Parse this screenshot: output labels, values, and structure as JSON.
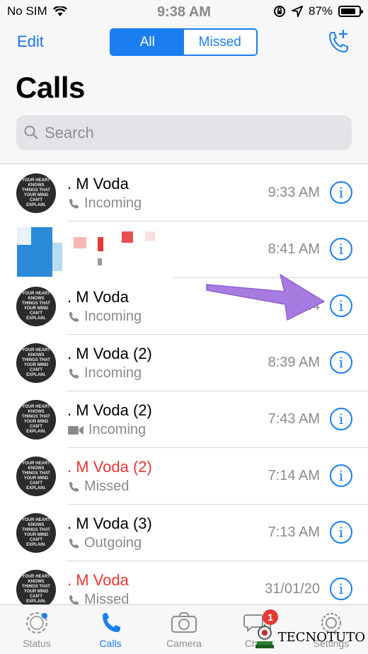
{
  "status": {
    "carrier": "No SIM",
    "time": "9:38 AM",
    "battery": "87%"
  },
  "header": {
    "edit_label": "Edit",
    "tabs": [
      {
        "label": "All",
        "selected": true
      },
      {
        "label": "Missed",
        "selected": false
      }
    ],
    "title": "Calls",
    "search_placeholder": "Search"
  },
  "calls": [
    {
      "name": ". M Voda",
      "type": "Incoming",
      "time": "9:33 AM",
      "missed": false,
      "icon": "phone-icon"
    },
    {
      "name": "",
      "type": "",
      "time": "8:41 AM",
      "missed": false,
      "icon": ""
    },
    {
      "name": ". M Voda",
      "type": "Incoming",
      "time": "8:4",
      "missed": false,
      "icon": "phone-icon"
    },
    {
      "name": ". M Voda  (2)",
      "type": "Incoming",
      "time": "8:39 AM",
      "missed": false,
      "icon": "phone-icon"
    },
    {
      "name": ". M Voda  (2)",
      "type": "Incoming",
      "time": "7:43 AM",
      "missed": false,
      "icon": "video-icon"
    },
    {
      "name": ". M Voda  (2)",
      "type": "Missed",
      "time": "7:14 AM",
      "missed": true,
      "icon": "phone-icon"
    },
    {
      "name": ". M Voda  (3)",
      "type": "Outgoing",
      "time": "7:13 AM",
      "missed": false,
      "icon": "phone-icon"
    },
    {
      "name": ". M Voda",
      "type": "Missed",
      "time": "31/01/20",
      "missed": true,
      "icon": "phone-icon"
    }
  ],
  "avatar_text": "YOUR HEART KNOWS THINGS THAT YOUR MIND CAN'T EXPLAIN.",
  "tabbar": {
    "tabs": [
      {
        "label": "Status",
        "active": false
      },
      {
        "label": "Calls",
        "active": true
      },
      {
        "label": "Camera",
        "active": false
      },
      {
        "label": "Chats",
        "active": false,
        "badge": "1"
      },
      {
        "label": "Settings",
        "active": false
      }
    ]
  },
  "watermark": "TECNOTUTO",
  "colors": {
    "accent": "#1a7ef0",
    "missed": "#e53935",
    "annotation_arrow": "#a77be0"
  }
}
